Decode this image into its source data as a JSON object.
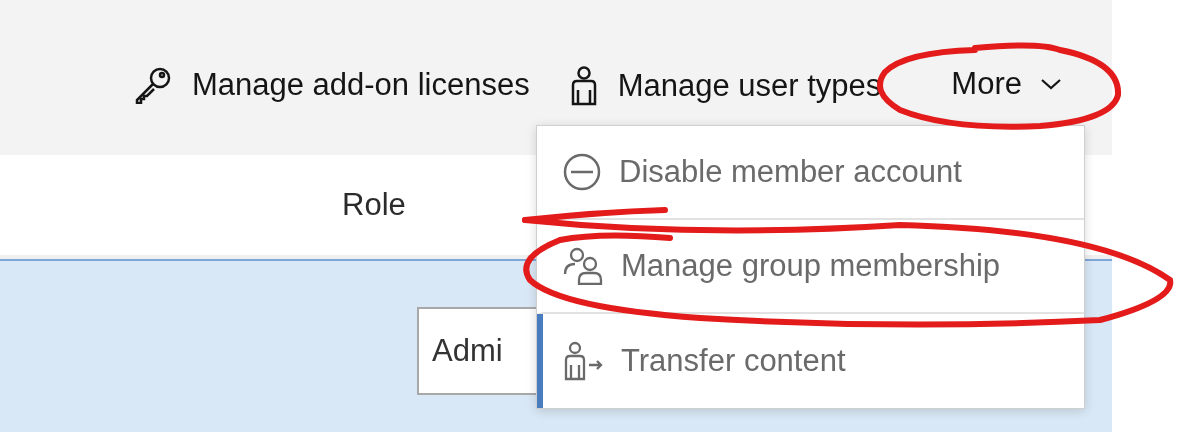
{
  "toolbar": {
    "actions": [
      {
        "label": "Manage add-on licenses",
        "kind": "key"
      },
      {
        "label": "Manage user types",
        "kind": "user"
      }
    ],
    "more": {
      "label": "More",
      "expanded": true
    }
  },
  "table": {
    "columns": [
      {
        "label": "Role"
      }
    ],
    "rows": [
      {
        "selected": true,
        "role": "Admi"
      }
    ]
  },
  "menu": {
    "items": [
      {
        "label": "Disable member account",
        "kind": "disable",
        "focused": false
      },
      {
        "label": "Manage group membership",
        "kind": "groups",
        "focused": false
      },
      {
        "label": "Transfer content",
        "kind": "transfer",
        "focused": true
      }
    ]
  }
}
